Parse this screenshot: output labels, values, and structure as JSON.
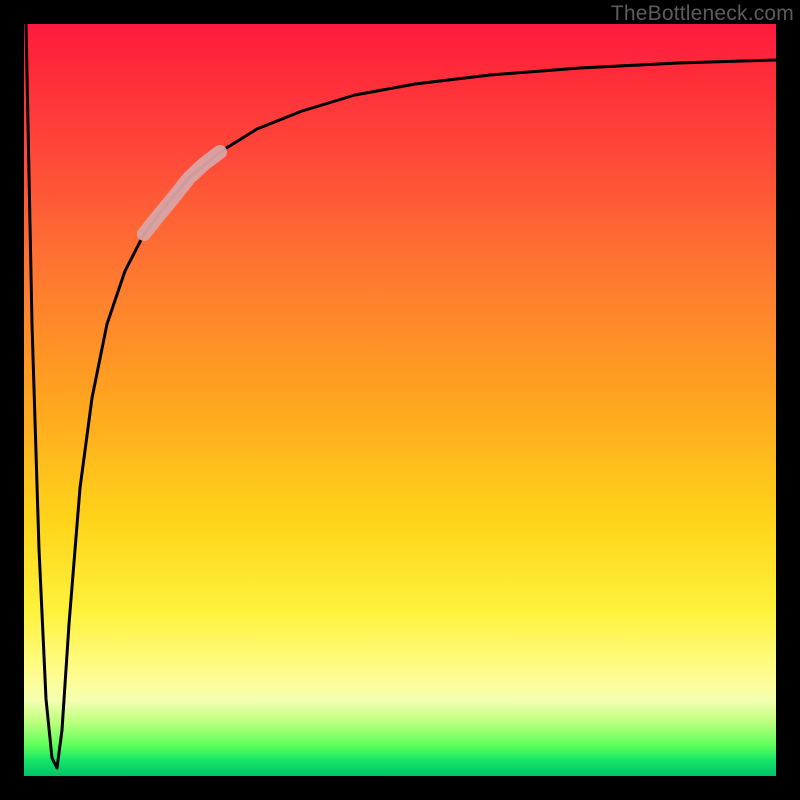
{
  "watermark": "TheBottleneck.com",
  "chart_data": {
    "type": "line",
    "title": "",
    "xlabel": "",
    "ylabel": "",
    "xlim": [
      0,
      100
    ],
    "ylim": [
      0,
      100
    ],
    "background_gradient": {
      "direction": "vertical",
      "stops": [
        {
          "pos": 0.0,
          "color": "#ff1a3e"
        },
        {
          "pos": 0.18,
          "color": "#ff4a39"
        },
        {
          "pos": 0.5,
          "color": "#ffa41f"
        },
        {
          "pos": 0.78,
          "color": "#fff23a"
        },
        {
          "pos": 0.93,
          "color": "#b7ff7a"
        },
        {
          "pos": 1.0,
          "color": "#00c466"
        }
      ]
    },
    "series": [
      {
        "name": "bottleneck-curve",
        "color": "#000000",
        "x": [
          0.3,
          1.0,
          2.0,
          3.0,
          3.8,
          4.4,
          5.0,
          6.0,
          7.5,
          9.0,
          11.0,
          13.5,
          16.0,
          19.0,
          22.0,
          26.0,
          31.0,
          37.0,
          44.0,
          52.0,
          62.0,
          74.0,
          87.0,
          100.0
        ],
        "y": [
          100,
          60,
          30,
          10,
          2,
          1,
          6,
          20,
          38,
          50,
          60,
          67,
          72,
          76,
          79.5,
          83,
          86,
          88.5,
          90.5,
          92,
          93.2,
          94.2,
          94.8,
          95.2
        ]
      },
      {
        "name": "highlight-segment",
        "color": "#d9a4a4",
        "x": [
          16.0,
          18.0,
          20.0,
          22.0,
          24.0,
          26.0
        ],
        "y": [
          72.0,
          74.5,
          77.0,
          79.5,
          81.3,
          83.0
        ]
      }
    ],
    "annotations": []
  }
}
